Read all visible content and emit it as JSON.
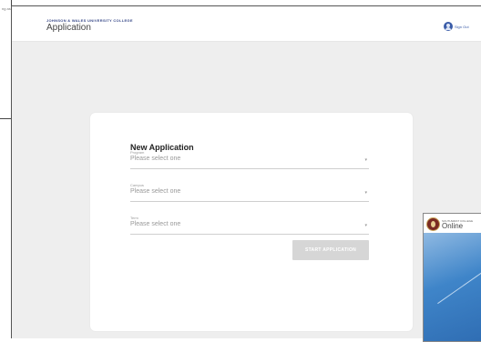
{
  "background_doc": {
    "lines": [
      "",
      "ng assets."
    ]
  },
  "header": {
    "college": "JOHNSON & WALES UNIVERSITY COLLEGE",
    "title": "Application",
    "sign_out": "Sign Out"
  },
  "form": {
    "title": "New Application",
    "fields": [
      {
        "label": "Program",
        "placeholder": "Please select one"
      },
      {
        "label": "Campus",
        "placeholder": "Please select one"
      },
      {
        "label": "Term",
        "placeholder": "Please select one"
      }
    ],
    "submit_label": "START APPLICATION"
  },
  "thumbnail": {
    "college": "SOUTHWEST COLLEGE",
    "title": "Online"
  },
  "colors": {
    "accent": "#3a5ca8",
    "card": "#ffffff",
    "page_bg": "#eeeeee",
    "button_disabled": "#d6d6d6"
  }
}
